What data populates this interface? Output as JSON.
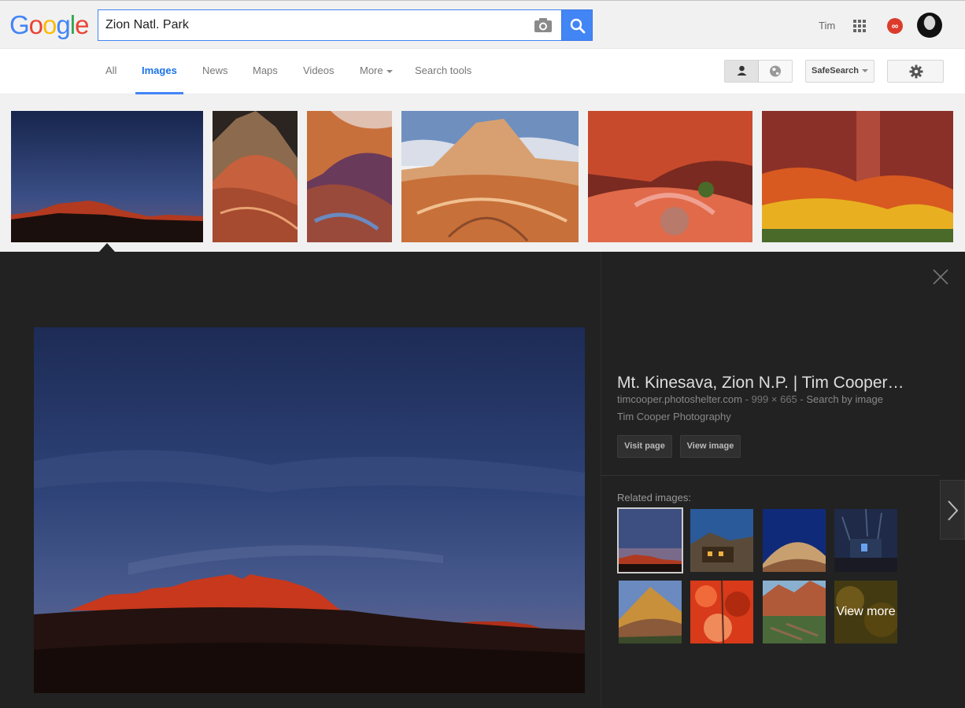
{
  "header": {
    "logo_letters": [
      "G",
      "o",
      "o",
      "g",
      "l",
      "e"
    ],
    "search_value": "Zion Natl. Park",
    "user_name": "Tim",
    "notification_glyph": "∞"
  },
  "nav": {
    "tabs": [
      {
        "label": "All"
      },
      {
        "label": "Images"
      },
      {
        "label": "News"
      },
      {
        "label": "Maps"
      },
      {
        "label": "Videos"
      },
      {
        "label": "More"
      },
      {
        "label": "Search tools"
      }
    ],
    "active_tab": "Images",
    "safesearch_label": "SafeSearch"
  },
  "thumbnails": [
    {
      "icon": "thumbnail-night-sunset"
    },
    {
      "icon": "thumbnail-checkerboard-mesa"
    },
    {
      "icon": "thumbnail-canyon-wall"
    },
    {
      "icon": "thumbnail-slickrock"
    },
    {
      "icon": "thumbnail-red-rocks"
    },
    {
      "icon": "thumbnail-autumn-trees"
    }
  ],
  "preview": {
    "title": "Mt. Kinesava, Zion N.P. | Tim Cooper…",
    "domain": "timcooper.photoshelter.com",
    "sep1": "-",
    "dimensions": "999 × 665",
    "sep2": "-",
    "search_by_image": "Search by image",
    "source": "Tim Cooper Photography",
    "visit_page_label": "Visit page",
    "view_image_label": "View image",
    "related_label": "Related images:",
    "view_more_label": "View more"
  },
  "colors": {
    "google_blue": "#4285f4",
    "google_red": "#ea4335",
    "google_yellow": "#fbbc05",
    "google_green": "#34a853",
    "preview_bg": "#222222"
  }
}
